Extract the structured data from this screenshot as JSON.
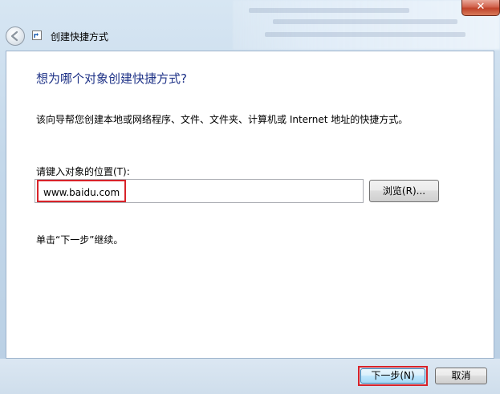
{
  "window": {
    "title": "创建快捷方式",
    "close_symbol": "✕"
  },
  "wizard": {
    "heading": "想为哪个对象创建快捷方式?",
    "description": "该向导帮您创建本地或网络程序、文件、文件夹、计算机或 Internet 地址的快捷方式。",
    "location_label": "请键入对象的位置(T):",
    "location_value": "www.baidu.com",
    "browse_label": "浏览(R)...",
    "hint": "单击“下一步”继续。"
  },
  "footer": {
    "next_label": "下一步(N)",
    "cancel_label": "取消"
  },
  "colors": {
    "heading": "#1e3287",
    "highlight_outline": "#d8232a"
  }
}
